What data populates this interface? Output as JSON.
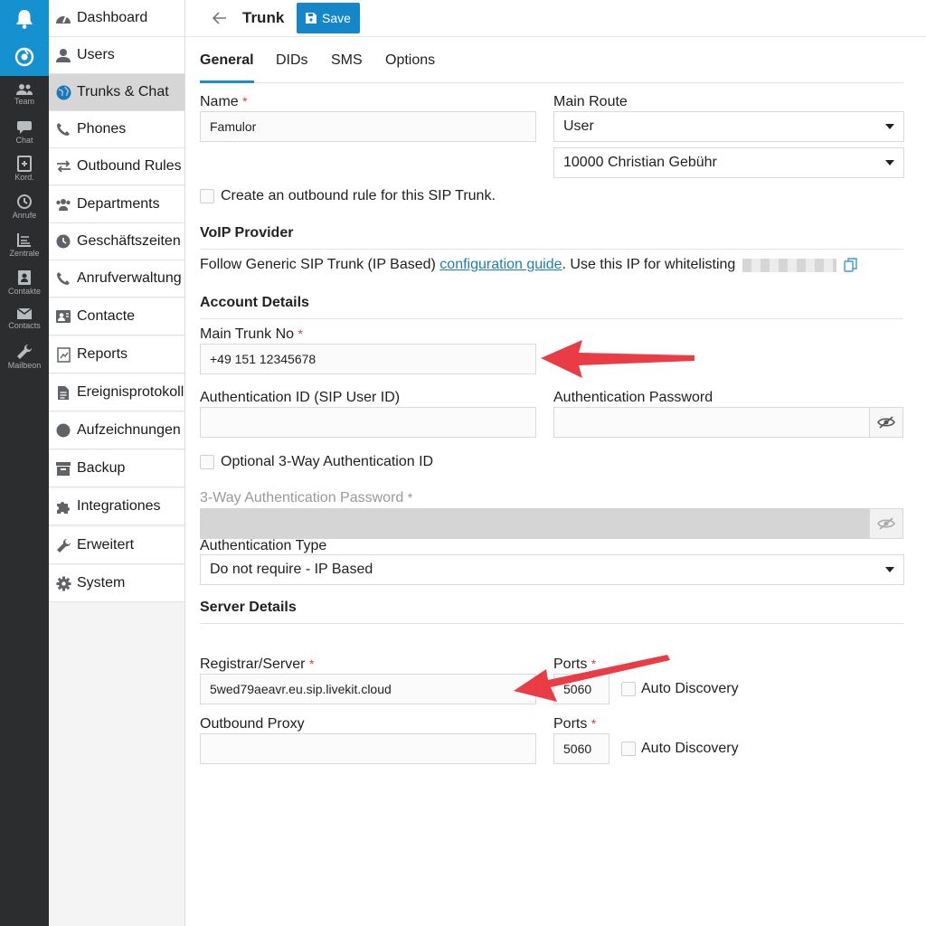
{
  "rail": {
    "items": [
      {
        "label": "Team",
        "icon": "team-icon"
      },
      {
        "label": "Chat",
        "icon": "chat-icon"
      },
      {
        "label": "Kord.",
        "icon": "coord-icon"
      },
      {
        "label": "Anrufe",
        "icon": "history-icon"
      },
      {
        "label": "Zentrale",
        "icon": "switchboard-icon"
      },
      {
        "label": "Contakte",
        "icon": "contact-card-icon"
      },
      {
        "label": "Contacts",
        "icon": "mail-icon"
      },
      {
        "label": "Mailbeon",
        "icon": "wrench-icon"
      }
    ]
  },
  "sidebar": {
    "items": [
      {
        "label": "Dashboard",
        "icon": "dashboard-icon",
        "active": false
      },
      {
        "label": "Users",
        "icon": "user-icon",
        "active": false
      },
      {
        "label": "Trunks & Chat",
        "icon": "globe-icon",
        "active": true
      },
      {
        "label": "Phones",
        "icon": "phone-icon",
        "active": false
      },
      {
        "label": "Outbound Rules",
        "icon": "arrows-icon",
        "active": false
      },
      {
        "label": "Departments",
        "icon": "group-icon",
        "active": false
      },
      {
        "label": "Geschäftszeiten",
        "icon": "clock-icon",
        "active": false
      },
      {
        "label": "Anrufverwaltung",
        "icon": "phone-icon",
        "active": false
      },
      {
        "label": "Contacte",
        "icon": "contact-card-icon",
        "active": false
      },
      {
        "label": "Reports",
        "icon": "report-icon",
        "active": false
      },
      {
        "label": "Ereignisprotokoll",
        "icon": "document-icon",
        "active": false
      },
      {
        "label": "Aufzeichnungen",
        "icon": "record-icon",
        "active": false
      },
      {
        "label": "Backup",
        "icon": "archive-icon",
        "active": false
      },
      {
        "label": "Integrationes",
        "icon": "puzzle-icon",
        "active": false
      },
      {
        "label": "Erweitert",
        "icon": "wrench-icon",
        "active": false
      },
      {
        "label": "System",
        "icon": "gear-icon",
        "active": false
      }
    ]
  },
  "header": {
    "title": "Trunk",
    "save_label": "Save"
  },
  "tabs": [
    "General",
    "DIDs",
    "SMS",
    "Options"
  ],
  "general": {
    "name_label": "Name",
    "name_value": "Famulor",
    "main_route_label": "Main Route",
    "main_route_value": "User",
    "main_route_user": "10000 Christian Gebühr",
    "outbound_rule_label": "Create an outbound rule for this SIP Trunk."
  },
  "voip": {
    "title": "VoIP Provider",
    "text_before": "Follow Generic SIP Trunk (IP Based) ",
    "link": "configuration guide",
    "text_after": ". Use this IP for whitelisting"
  },
  "account": {
    "title": "Account Details",
    "main_trunk_label": "Main Trunk No",
    "main_trunk_value": "+49 151 12345678",
    "auth_id_label": "Authentication ID (SIP User ID)",
    "auth_id_value": "",
    "auth_pw_label": "Authentication Password",
    "auth_pw_value": "",
    "three_way_id_label": "Optional 3-Way Authentication ID",
    "three_way_pw_label": "3-Way Authentication Password",
    "auth_type_label": "Authentication Type",
    "auth_type_value": "Do not require - IP Based"
  },
  "server": {
    "title": "Server Details",
    "registrar_label": "Registrar/Server",
    "registrar_value": "5wed79aeavr.eu.sip.livekit.cloud",
    "ports_label": "Ports",
    "registrar_port": "5060",
    "auto_discovery_label": "Auto Discovery",
    "proxy_label": "Outbound Proxy",
    "proxy_value": "",
    "proxy_port": "5060"
  },
  "colors": {
    "accent": "#1691d0",
    "required": "#d0453c",
    "annotation_arrow": "#e8313a"
  }
}
